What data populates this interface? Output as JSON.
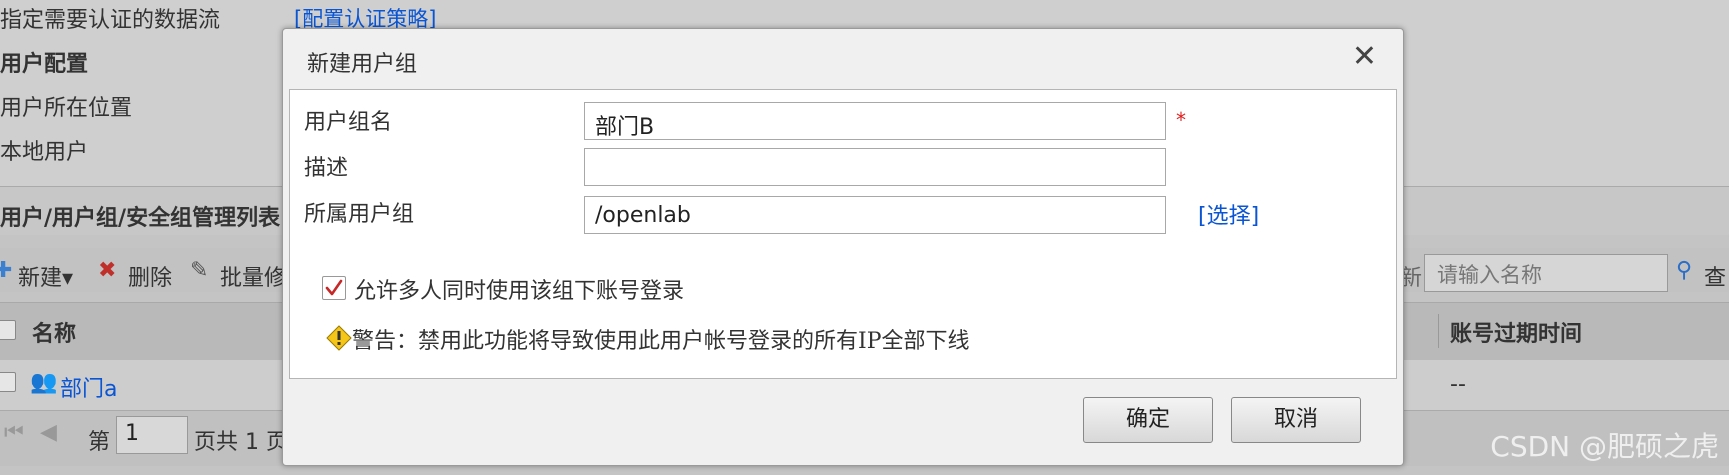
{
  "background": {
    "rows": {
      "specify_flow_label": "指定需要认证的数据流",
      "config_policy_link": "[配置认证策略]",
      "user_config_label": "用户配置",
      "user_location_label": "用户所在位置",
      "local_user_label": "本地用户"
    },
    "section_title": "用户/用户组/安全组管理列表",
    "toolbar": {
      "new_label": "新建▾",
      "delete_label": "删除",
      "batch_label": "批量修",
      "search_partial": "新",
      "search_placeholder": "请输入名称",
      "search_label": "查"
    },
    "table": {
      "col_name": "名称",
      "col_expire": "账号过期时间",
      "rows": [
        {
          "name": "部门a",
          "expire": "--"
        }
      ]
    },
    "pager": {
      "page_prefix": "第",
      "page_value": "1",
      "page_suffix": "页共 1 页"
    }
  },
  "dialog": {
    "title": "新建用户组",
    "close_icon": "close-icon",
    "fields": {
      "group_name_label": "用户组名",
      "group_name_value": "部门B",
      "required_mark": "*",
      "description_label": "描述",
      "description_value": "",
      "parent_group_label": "所属用户组",
      "parent_group_value": "/openlab",
      "select_link": "[选择]"
    },
    "allow_multi_login": {
      "checked": true,
      "label": "允许多人同时使用该组下账号登录"
    },
    "warning": {
      "icon": "warning-icon",
      "text": "警告：禁用此功能将导致使用此用户帐号登录的所有IP全部下线"
    },
    "buttons": {
      "ok": "确定",
      "cancel": "取消"
    }
  },
  "watermark": "CSDN @肥硕之虎"
}
